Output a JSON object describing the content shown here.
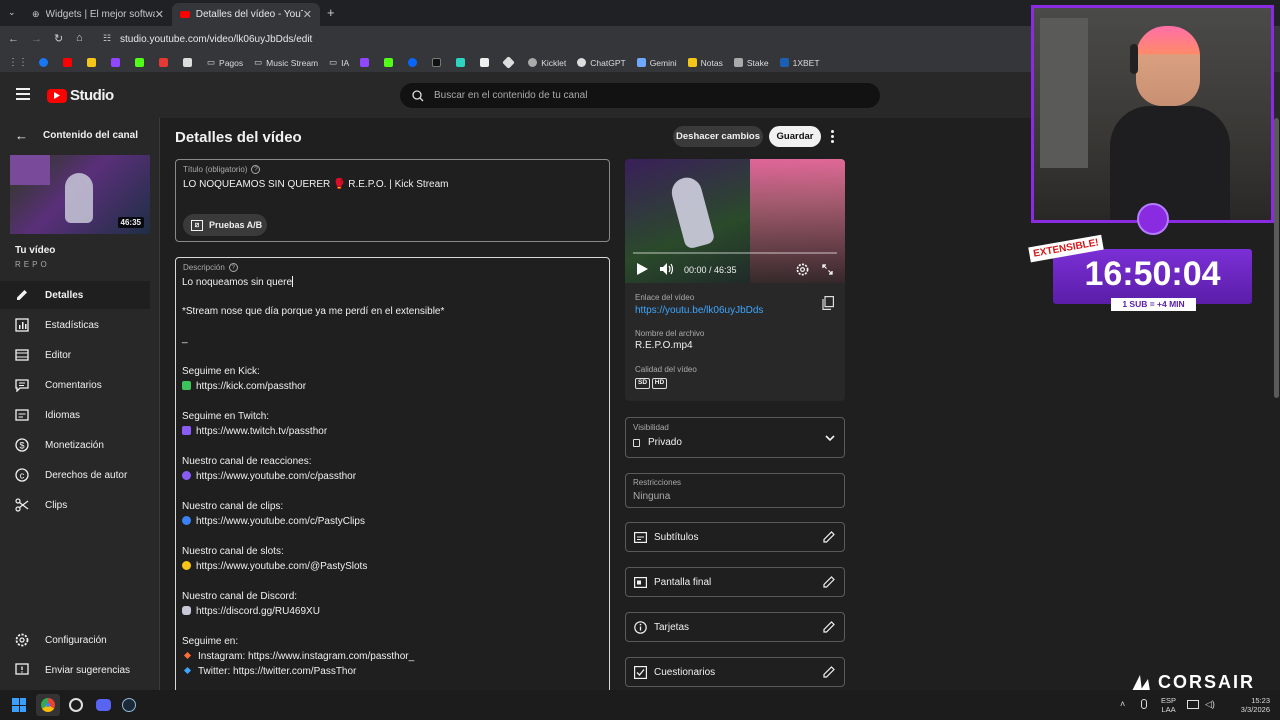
{
  "browser": {
    "tabs": [
      {
        "title": "Widgets | El mejor software pa",
        "active": false
      },
      {
        "title": "Detalles del vídeo - YouTube St",
        "active": true
      }
    ],
    "url": "studio.youtube.com/video/lk06uyJbDds/edit",
    "bookmarks": [
      "Pagos",
      "Music Stream",
      "IA",
      "Kicklet",
      "ChatGPT",
      "Gemini",
      "Notas",
      "Stake",
      "1XBET"
    ]
  },
  "studio": {
    "logo": "Studio",
    "search_placeholder": "Buscar en el contenido de tu canal"
  },
  "sidebar": {
    "back_label": "Contenido del canal",
    "thumb_duration": "46:35",
    "your_video": "Tu vídeo",
    "video_name": "REPO",
    "items": [
      {
        "label": "Detalles",
        "icon": "pencil-icon",
        "active": true
      },
      {
        "label": "Estadísticas",
        "icon": "chart-icon"
      },
      {
        "label": "Editor",
        "icon": "film-icon"
      },
      {
        "label": "Comentarios",
        "icon": "comment-icon"
      },
      {
        "label": "Idiomas",
        "icon": "subtitles-icon"
      },
      {
        "label": "Monetización",
        "icon": "dollar-icon"
      },
      {
        "label": "Derechos de autor",
        "icon": "copyright-icon"
      },
      {
        "label": "Clips",
        "icon": "scissors-icon"
      }
    ],
    "settings": "Configuración",
    "feedback": "Enviar sugerencias"
  },
  "main": {
    "page_title": "Detalles del vídeo",
    "undo": "Deshacer cambios",
    "save": "Guardar",
    "title_label": "Título (obligatorio)",
    "title_value": "LO NOQUEAMOS SIN QUERER 🥊 R.E.P.O. | Kick Stream",
    "ab_button": "Pruebas A/B",
    "desc_label": "Descripción",
    "description": {
      "line1": "Lo noqueamos sin quere",
      "line2": "*Stream nose que día porque ya me perdí en el extensible*",
      "sep": "_",
      "kick_h": "Seguime en Kick:",
      "kick_url": "https://kick.com/passthor",
      "twitch_h": "Seguime en Twitch:",
      "twitch_url": "https://www.twitch.tv/passthor",
      "react_h": "Nuestro canal de reacciones:",
      "react_url": "https://www.youtube.com/c/passthor",
      "clips_h": "Nuestro canal de clips:",
      "clips_url": "https://www.youtube.com/c/PastyClips",
      "slots_h": "Nuestro canal de slots:",
      "slots_url": "https://www.youtube.com/@PastySlots",
      "discord_h": "Nuestro canal de Discord:",
      "discord_url": "https://discord.gg/RU469XU",
      "follow_h": "Seguime en:",
      "instagram": "Instagram: https://www.instagram.com/passthor_",
      "twitter": "Twitter: https://twitter.com/PassThor"
    }
  },
  "right": {
    "player_time": "00:00 / 46:35",
    "link_label": "Enlace del vídeo",
    "link": "https://youtu.be/lk06uyJbDds",
    "file_label": "Nombre del archivo",
    "file": "R.E.P.O.mp4",
    "quality_label": "Calidad del vídeo",
    "quality_sd": "SD",
    "quality_hd": "HD",
    "visibility_label": "Visibilidad",
    "visibility": "Privado",
    "restrictions_label": "Restricciones",
    "restrictions": "Ninguna",
    "rows": [
      "Subtítulos",
      "Pantalla final",
      "Tarjetas",
      "Cuestionarios"
    ]
  },
  "overlay": {
    "badge": "EXTENSIBLE!",
    "timer": "16:50:04",
    "sub": "1 SUB = +4 MIN",
    "brand": "CORSAIR"
  },
  "taskbar": {
    "lang1": "ESP",
    "lang2": "LAA",
    "time": "15:23",
    "date": "3/3/2026"
  },
  "colors": {
    "accent_purple": "#8a2be2",
    "link_blue": "#3ea6ff",
    "yt_red": "#ff0000"
  }
}
